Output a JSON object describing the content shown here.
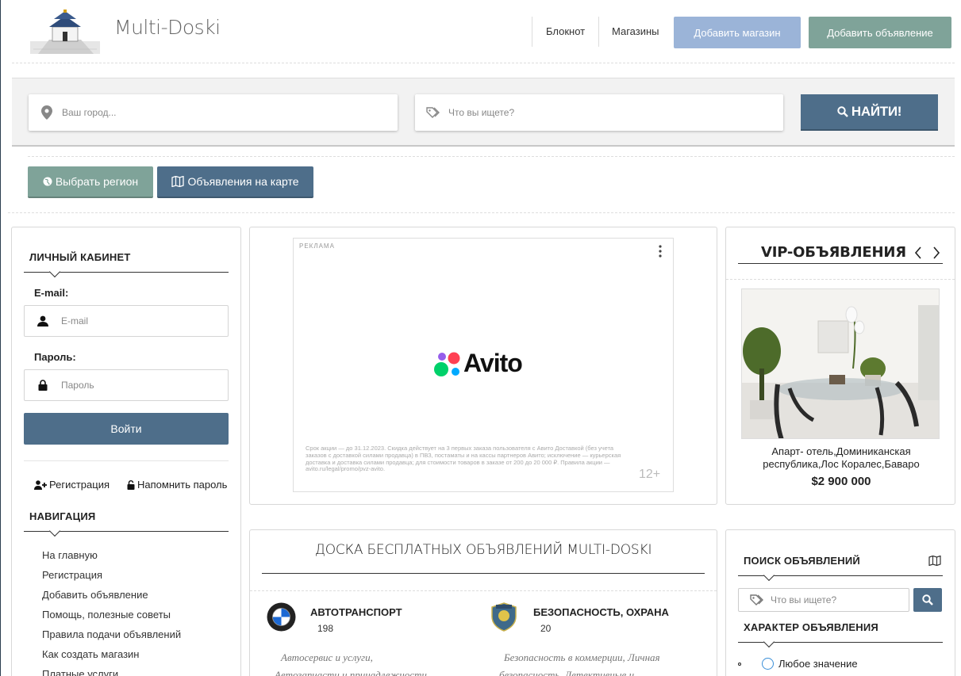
{
  "header": {
    "site_title": "Multi-Doski",
    "nav_notebook": "Блокнот",
    "nav_shops": "Магазины",
    "add_shop": "Добавить магазин",
    "add_ad": "Добавить объявление"
  },
  "search": {
    "city_placeholder": "Ваш город...",
    "query_placeholder": "Что вы ищете?",
    "find_label": "НАЙТИ!"
  },
  "region_button": "Выбрать регион",
  "map_button": "Объявления на карте",
  "login": {
    "title": "ЛИЧНЫЙ КАБИНЕТ",
    "email_label": "E-mail:",
    "email_placeholder": "E-mail",
    "password_label": "Пароль:",
    "password_placeholder": "Пароль",
    "submit": "Войти",
    "register": "Регистрация",
    "remind": "Напомнить пароль"
  },
  "navigation": {
    "title": "НАВИГАЦИЯ",
    "items": [
      "На главную",
      "Регистрация",
      "Добавить объявление",
      "Помощь, полезные советы",
      "Правила подачи объявлений",
      "Как создать магазин",
      "Платные услуги"
    ]
  },
  "ad": {
    "label": "РЕКЛАМА",
    "brand": "Avito",
    "fine_print": "Срок акции — до 31.12.2023. Скидка действует на 3 первых заказа пользователя с Авито Доставкой (без учета заказов с доставкой силами продавца) в ПВЗ, постаматы и на кассы партнеров Авито; исключение — курьерская доставка и доставка силами продавца; для стоимости товаров в заказе от 200 до 20 000 ₽. Правила акции — avito.ru/legal/promo/pvz-avito.",
    "age": "12+"
  },
  "vip": {
    "title": "VIP-ОБЪЯВЛЕНИЯ",
    "caption": "Апарт- отель,Доминиканская республика,Лос Коралес,Баваро",
    "price": "$2 900 000"
  },
  "board": {
    "title": "ДОСКА БЕСПЛАТНЫХ ОБЪЯВЛЕНИЙ MULTI-DOSKI",
    "categories": [
      {
        "name": "АВТОТРАНСПОРТ",
        "count": "198",
        "desc1": "Автосервис и услуги,",
        "desc2": "Автозапчасти и принадлежности"
      },
      {
        "name": "БЕЗОПАСНОСТЬ, ОХРАНА",
        "count": "20",
        "desc1": "Безопасность в коммерции, Личная",
        "desc2": "безопасность, Детективные и"
      }
    ]
  },
  "right_search": {
    "title": "ПОИСК ОБЪЯВЛЕНИЙ",
    "placeholder": "Что вы ищете?",
    "character_title": "ХАРАКТЕР ОБЪЯВЛЕНИЯ",
    "any_value": "Любое значение"
  },
  "colors": {
    "accent_blue": "#4e6e8a",
    "light_blue": "#9bb4d8",
    "teal": "#7fa399"
  }
}
